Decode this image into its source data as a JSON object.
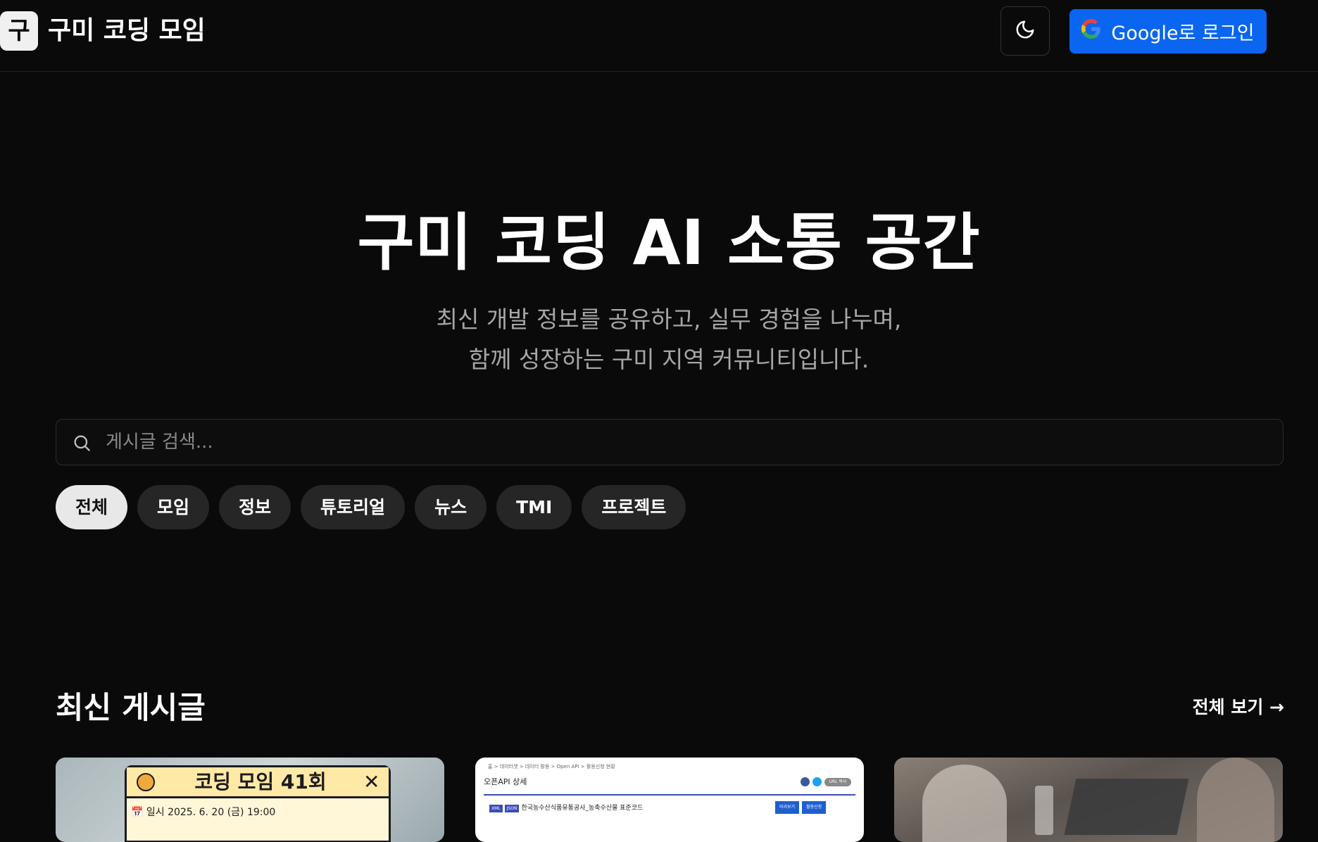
{
  "header": {
    "logo_char": "구",
    "site_title": "구미 코딩 모임",
    "theme_toggle_icon": "moon-icon",
    "login_label": "Google로 로그인",
    "login_icon": "google-icon"
  },
  "hero": {
    "title": "구미 코딩 AI 소통 공간",
    "subtitle_line1": "최신 개발 정보를 공유하고, 실무 경험을 나누며,",
    "subtitle_line2": "함께 성장하는 구미 지역 커뮤니티입니다."
  },
  "search": {
    "placeholder": "게시글 검색...",
    "value": ""
  },
  "categories": {
    "items": [
      {
        "label": "전체",
        "active": true
      },
      {
        "label": "모임",
        "active": false
      },
      {
        "label": "정보",
        "active": false
      },
      {
        "label": "튜토리얼",
        "active": false
      },
      {
        "label": "뉴스",
        "active": false
      },
      {
        "label": "TMI",
        "active": false
      },
      {
        "label": "프로젝트",
        "active": false
      }
    ]
  },
  "latest": {
    "title": "최신 게시글",
    "view_all": "전체 보기 →",
    "cards": [
      {
        "poster_title": "코딩 모임 41회",
        "poster_date": "📅 일시   2025. 6. 20 (금) 19:00"
      },
      {
        "breadcrumb": "홈  >  데이터셋  >  데이터 활용  >  Open API  >  활용신청 현황",
        "page_title": "오픈API 상세",
        "url_copy": "URL 복사",
        "tag1": "XML",
        "tag2": "JSON",
        "dataset_name": "한국농수산식품유통공사_농축수산물 표준코드",
        "btn_preview": "미리보기",
        "btn_apply": "활용신청"
      },
      {}
    ]
  },
  "colors": {
    "background": "#0a0a0a",
    "accent_blue": "#0a66f0",
    "chip_bg": "#262626",
    "chip_active_bg": "#e8e8e8"
  }
}
